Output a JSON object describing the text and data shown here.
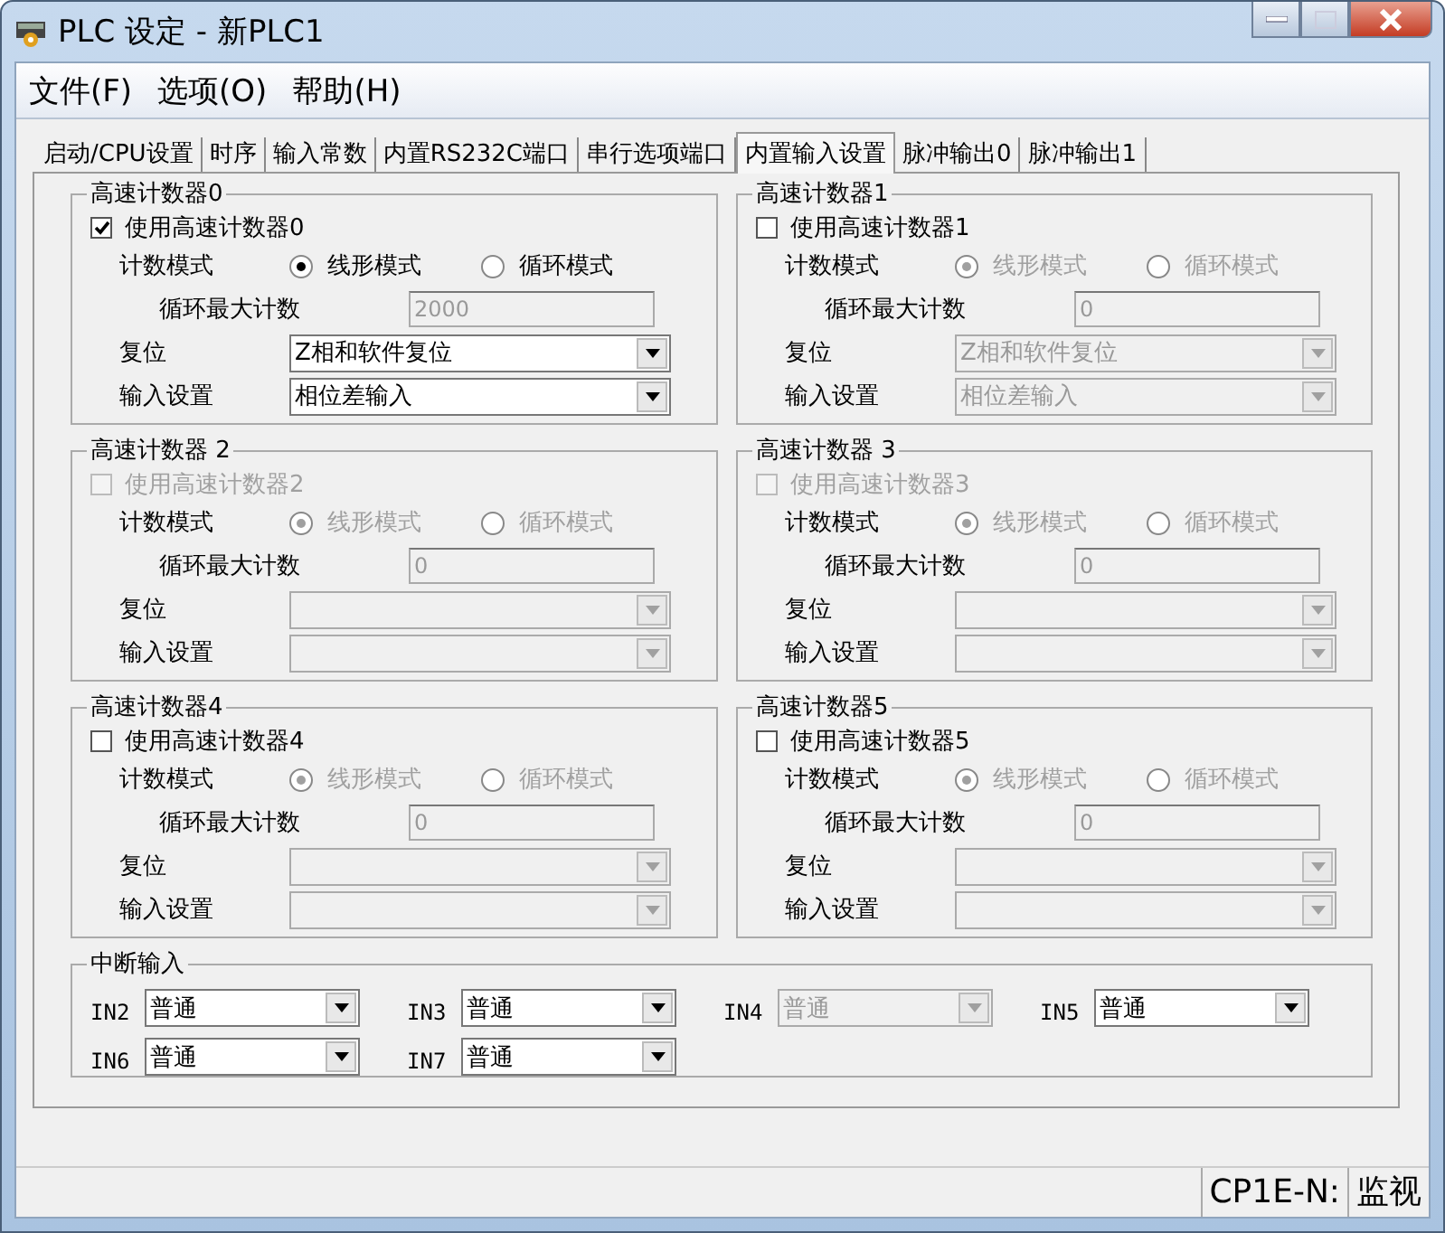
{
  "window": {
    "title": "PLC 设定 - 新PLC1"
  },
  "menu": [
    "文件(F)",
    "选项(O)",
    "帮助(H)"
  ],
  "tabs": [
    {
      "label": "启动/CPU设置",
      "selected": false
    },
    {
      "label": "时序",
      "selected": false
    },
    {
      "label": "输入常数",
      "selected": false
    },
    {
      "label": "内置RS232C端口",
      "selected": false
    },
    {
      "label": "串行选项端口",
      "selected": false
    },
    {
      "label": "内置输入设置",
      "selected": true
    },
    {
      "label": "脉冲输出0",
      "selected": false
    },
    {
      "label": "脉冲输出1",
      "selected": false
    }
  ],
  "counters": [
    {
      "title": "高速计数器0",
      "use": {
        "label": "使用高速计数器0",
        "checked": true,
        "disabled": false
      },
      "mode_label": "计数模式",
      "modes_disabled": false,
      "modes": [
        {
          "label": "线形模式",
          "selected": true
        },
        {
          "label": "循环模式",
          "selected": false
        }
      ],
      "max_label": "循环最大计数",
      "max_value": "2000",
      "reset_label": "复位",
      "reset": {
        "value": "Z相和软件复位",
        "disabled": false
      },
      "input_label": "输入设置",
      "input": {
        "value": "相位差输入",
        "disabled": false
      }
    },
    {
      "title": "高速计数器1",
      "use": {
        "label": "使用高速计数器1",
        "checked": false,
        "disabled": false
      },
      "mode_label": "计数模式",
      "modes_disabled": true,
      "modes": [
        {
          "label": "线形模式",
          "selected": true
        },
        {
          "label": "循环模式",
          "selected": false
        }
      ],
      "max_label": "循环最大计数",
      "max_value": "0",
      "reset_label": "复位",
      "reset": {
        "value": "Z相和软件复位",
        "disabled": true
      },
      "input_label": "输入设置",
      "input": {
        "value": "相位差输入",
        "disabled": true
      }
    },
    {
      "title": "高速计数器 2",
      "use": {
        "label": "使用高速计数器2",
        "checked": false,
        "disabled": true
      },
      "mode_label": "计数模式",
      "modes_disabled": true,
      "modes": [
        {
          "label": "线形模式",
          "selected": true
        },
        {
          "label": "循环模式",
          "selected": false
        }
      ],
      "max_label": "循环最大计数",
      "max_value": "0",
      "reset_label": "复位",
      "reset": {
        "disabled": true
      },
      "input_label": "输入设置",
      "input": {
        "disabled": true
      }
    },
    {
      "title": "高速计数器 3",
      "use": {
        "label": "使用高速计数器3",
        "checked": false,
        "disabled": true
      },
      "mode_label": "计数模式",
      "modes_disabled": true,
      "modes": [
        {
          "label": "线形模式",
          "selected": true
        },
        {
          "label": "循环模式",
          "selected": false
        }
      ],
      "max_label": "循环最大计数",
      "max_value": "0",
      "reset_label": "复位",
      "reset": {
        "disabled": true
      },
      "input_label": "输入设置",
      "input": {
        "disabled": true
      }
    },
    {
      "title": "高速计数器4",
      "use": {
        "label": "使用高速计数器4",
        "checked": false,
        "disabled": false
      },
      "mode_label": "计数模式",
      "modes_disabled": true,
      "modes": [
        {
          "label": "线形模式",
          "selected": true
        },
        {
          "label": "循环模式",
          "selected": false
        }
      ],
      "max_label": "循环最大计数",
      "max_value": "0",
      "reset_label": "复位",
      "reset": {
        "disabled": true
      },
      "input_label": "输入设置",
      "input": {
        "disabled": true
      }
    },
    {
      "title": "高速计数器5",
      "use": {
        "label": "使用高速计数器5",
        "checked": false,
        "disabled": false
      },
      "mode_label": "计数模式",
      "modes_disabled": true,
      "modes": [
        {
          "label": "线形模式",
          "selected": true
        },
        {
          "label": "循环模式",
          "selected": false
        }
      ],
      "max_label": "循环最大计数",
      "max_value": "0",
      "reset_label": "复位",
      "reset": {
        "disabled": true
      },
      "input_label": "输入设置",
      "input": {
        "disabled": true
      }
    }
  ],
  "interrupt": {
    "title": "中断输入",
    "rows": [
      [
        {
          "label": "IN2",
          "value": "普通",
          "disabled": false
        },
        {
          "label": "IN3",
          "value": "普通",
          "disabled": false
        },
        {
          "label": "IN4",
          "value": "普通",
          "disabled": true
        },
        {
          "label": "IN5",
          "value": "普通",
          "disabled": false
        }
      ],
      [
        {
          "label": "IN6",
          "value": "普通",
          "disabled": false
        },
        {
          "label": "IN7",
          "value": "普通",
          "disabled": false
        }
      ]
    ]
  },
  "status_bar": [
    "CP1E-N:",
    "监视"
  ]
}
